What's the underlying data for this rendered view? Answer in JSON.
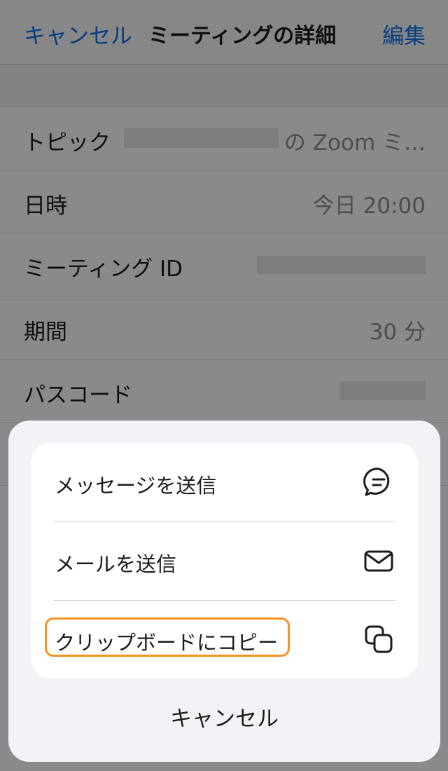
{
  "header": {
    "cancel_label": "キャンセル",
    "title": "ミーティングの詳細",
    "edit_label": "編集"
  },
  "details": {
    "topic_label": "トピック",
    "topic_value": "の Zoom ミ…",
    "datetime_label": "日時",
    "datetime_value": "今日 20:00",
    "meeting_id_label": "ミーティング ID",
    "duration_label": "期間",
    "duration_value": "30 分",
    "passcode_label": "パスコード"
  },
  "action_sheet": {
    "items": [
      {
        "label": "メッセージを送信",
        "icon": "message-bubble-icon"
      },
      {
        "label": "メールを送信",
        "icon": "envelope-icon"
      },
      {
        "label": "クリップボードにコピー",
        "icon": "copy-icon",
        "highlighted": true
      }
    ],
    "cancel_label": "キャンセル"
  },
  "colors": {
    "accent": "#0e71eb",
    "highlight": "#f7931e"
  }
}
